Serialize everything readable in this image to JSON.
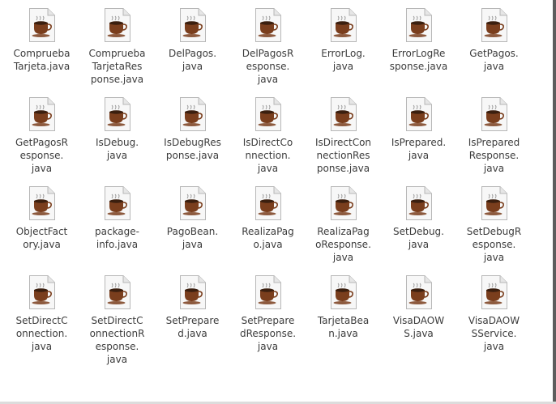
{
  "files": [
    {
      "name": "Comprueba\nTarjeta.java",
      "icon": "java-file-icon"
    },
    {
      "name": "Comprueba\nTarjetaRes\nponse.java",
      "icon": "java-file-icon"
    },
    {
      "name": "DelPagos.\njava",
      "icon": "java-file-icon"
    },
    {
      "name": "DelPagosR\nesponse.\njava",
      "icon": "java-file-icon"
    },
    {
      "name": "ErrorLog.\njava",
      "icon": "java-file-icon"
    },
    {
      "name": "ErrorLogRe\nsponse.java",
      "icon": "java-file-icon"
    },
    {
      "name": "GetPagos.\njava",
      "icon": "java-file-icon"
    },
    {
      "name": "GetPagosR\nesponse.\njava",
      "icon": "java-file-icon"
    },
    {
      "name": "IsDebug.\njava",
      "icon": "java-file-icon"
    },
    {
      "name": "IsDebugRes\nponse.java",
      "icon": "java-file-icon"
    },
    {
      "name": "IsDirectCo\nnnection.\njava",
      "icon": "java-file-icon"
    },
    {
      "name": "IsDirectCon\nnectionRes\nponse.java",
      "icon": "java-file-icon"
    },
    {
      "name": "IsPrepared.\njava",
      "icon": "java-file-icon"
    },
    {
      "name": "IsPrepared\nResponse.\njava",
      "icon": "java-file-icon"
    },
    {
      "name": "ObjectFact\nory.java",
      "icon": "java-file-icon"
    },
    {
      "name": "package-\ninfo.java",
      "icon": "java-file-icon"
    },
    {
      "name": "PagoBean.\njava",
      "icon": "java-file-icon"
    },
    {
      "name": "RealizaPag\no.java",
      "icon": "java-file-icon"
    },
    {
      "name": "RealizaPag\noResponse.\njava",
      "icon": "java-file-icon"
    },
    {
      "name": "SetDebug.\njava",
      "icon": "java-file-icon"
    },
    {
      "name": "SetDebugR\nesponse.\njava",
      "icon": "java-file-icon"
    },
    {
      "name": "SetDirectC\nonnection.\njava",
      "icon": "java-file-icon"
    },
    {
      "name": "SetDirectC\nonnectionR\nesponse.\njava",
      "icon": "java-file-icon"
    },
    {
      "name": "SetPrepare\nd.java",
      "icon": "java-file-icon"
    },
    {
      "name": "SetPrepare\ndResponse.\njava",
      "icon": "java-file-icon"
    },
    {
      "name": "TarjetaBea\nn.java",
      "icon": "java-file-icon"
    },
    {
      "name": "VisaDAOW\nS.java",
      "icon": "java-file-icon"
    },
    {
      "name": "VisaDAOW\nSService.\njava",
      "icon": "java-file-icon"
    }
  ],
  "colors": {
    "label": "#3c3c3c",
    "page_fill": "#f7f7f7",
    "page_border": "#b7b7b7",
    "cup": "#7a3e1d",
    "coffee": "#3b1f0f"
  }
}
